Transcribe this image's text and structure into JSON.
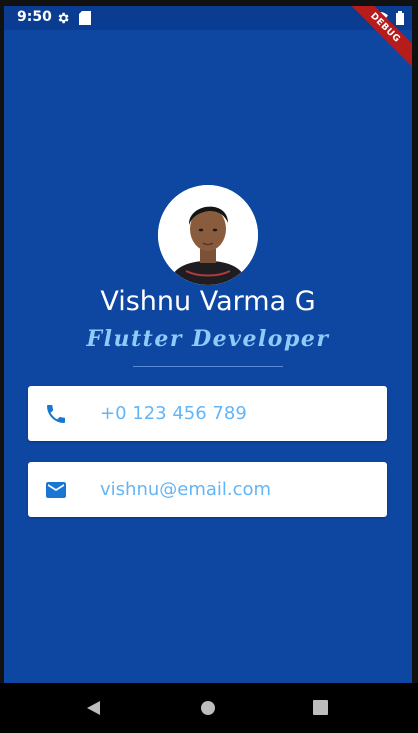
{
  "status_bar": {
    "time": "9:50",
    "left_icons": [
      "gear-icon",
      "sd-card-icon"
    ],
    "right_icons": [
      "wifi-icon",
      "battery-icon"
    ],
    "debug_label": "DEBUG"
  },
  "profile": {
    "name": "Vishnu Varma G",
    "title": "Flutter Developer"
  },
  "contacts": {
    "phone": {
      "icon": "phone-icon",
      "value": "+0 123 456 789"
    },
    "email": {
      "icon": "email-icon",
      "value": "vishnu@email.com"
    }
  },
  "nav_bar": {
    "buttons": [
      "back-icon",
      "home-icon",
      "recents-icon"
    ]
  },
  "colors": {
    "background": "#0D47A1",
    "accent": "#64B5F6",
    "title": "#90CAF9",
    "card": "#FFFFFF",
    "debug": "#B71C1C"
  }
}
